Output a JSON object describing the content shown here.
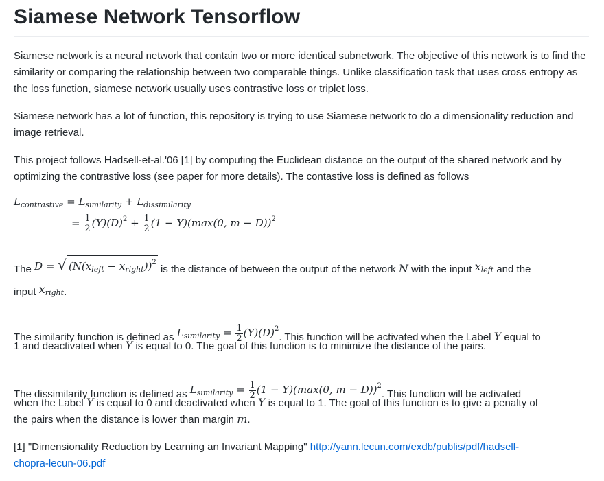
{
  "title": "Siamese Network Tensorflow",
  "paragraphs": {
    "p1": "Siamese network is a neural network that contain two or more identical subnetwork. The objective of this network is to find the similarity or comparing the relationship between two comparable things. Unlike classification task that uses cross entropy as the loss function, siamese network usually uses contrastive loss or triplet loss.",
    "p2": "Siamese network has a lot of function, this repository is trying to use Siamese network to do a dimensionality reduction and image retrieval.",
    "p3": "This project follows Hadsell-et-al.'06 [1] by computing the Euclidean distance on the output of the shared network and by optimizing the contrastive loss (see paper for more details). The contastive loss is defined as follows"
  },
  "equation": {
    "lhs": "L",
    "lhs_sub": "contrastive",
    "eq": "=",
    "rhs_a": "L",
    "rhs_a_sub": "similarity",
    "plus": "+",
    "rhs_b": "L",
    "rhs_b_sub": "dissimilarity",
    "line2_eq": "=",
    "half_num": "1",
    "half_den": "2",
    "term1": "(Y)(D)",
    "sq": "2",
    "plus2": "+",
    "term2": "(1 − Y)(max(0, m − D))"
  },
  "distance": {
    "prefix": "The",
    "d": "D",
    "eq": "=",
    "radical": "√",
    "body": "(N(x",
    "left_sub": "left",
    "minus": " − x",
    "right_sub": "right",
    "close": "))",
    "sq": "2",
    "text_a": "is the distance of between the output of the network",
    "n": "N",
    "text_b": "with the input",
    "x1": "x",
    "x1_sub": "left",
    "text_c": "and the",
    "text_d": "input",
    "x2": "x",
    "x2_sub": "right",
    "period": "."
  },
  "similarity": {
    "prefix": "The similarity function is defined as",
    "l": "L",
    "l_sub": "similarity",
    "eq": "=",
    "num": "1",
    "den": "2",
    "term": "(Y)(D)",
    "sq": "2",
    "text_a": ". This function will be activated when the Label",
    "y1": "Y",
    "text_b": "equal to",
    "text_c": "1 and deactivated when",
    "y2": "Y",
    "text_d": "is equal to 0. The goal of this function is to minimize the distance of the pairs."
  },
  "dissimilarity": {
    "prefix": "The dissimilarity function is defined as",
    "l": "L",
    "l_sub": "similarity",
    "eq": "=",
    "num": "1",
    "den": "2",
    "term": "(1 − Y)(max(0, m − D))",
    "sq": "2",
    "text_a": ". This function will be activated",
    "text_b": "when the Label",
    "y1": "Y",
    "text_c": "is equal to 0 and deactivated when",
    "y2": "Y",
    "text_d": "is equal to 1. The goal of this function is to give a penalty of",
    "text_e": "the pairs when the distance is lower than margin",
    "m": "m",
    "period": "."
  },
  "reference": {
    "text": "[1] \"Dimensionality Reduction by Learning an Invariant Mapping\"",
    "link_line1": "http://yann.lecun.com/exdb/publis/pdf/hadsell-",
    "link_line2": "chopra-lecun-06.pdf"
  }
}
